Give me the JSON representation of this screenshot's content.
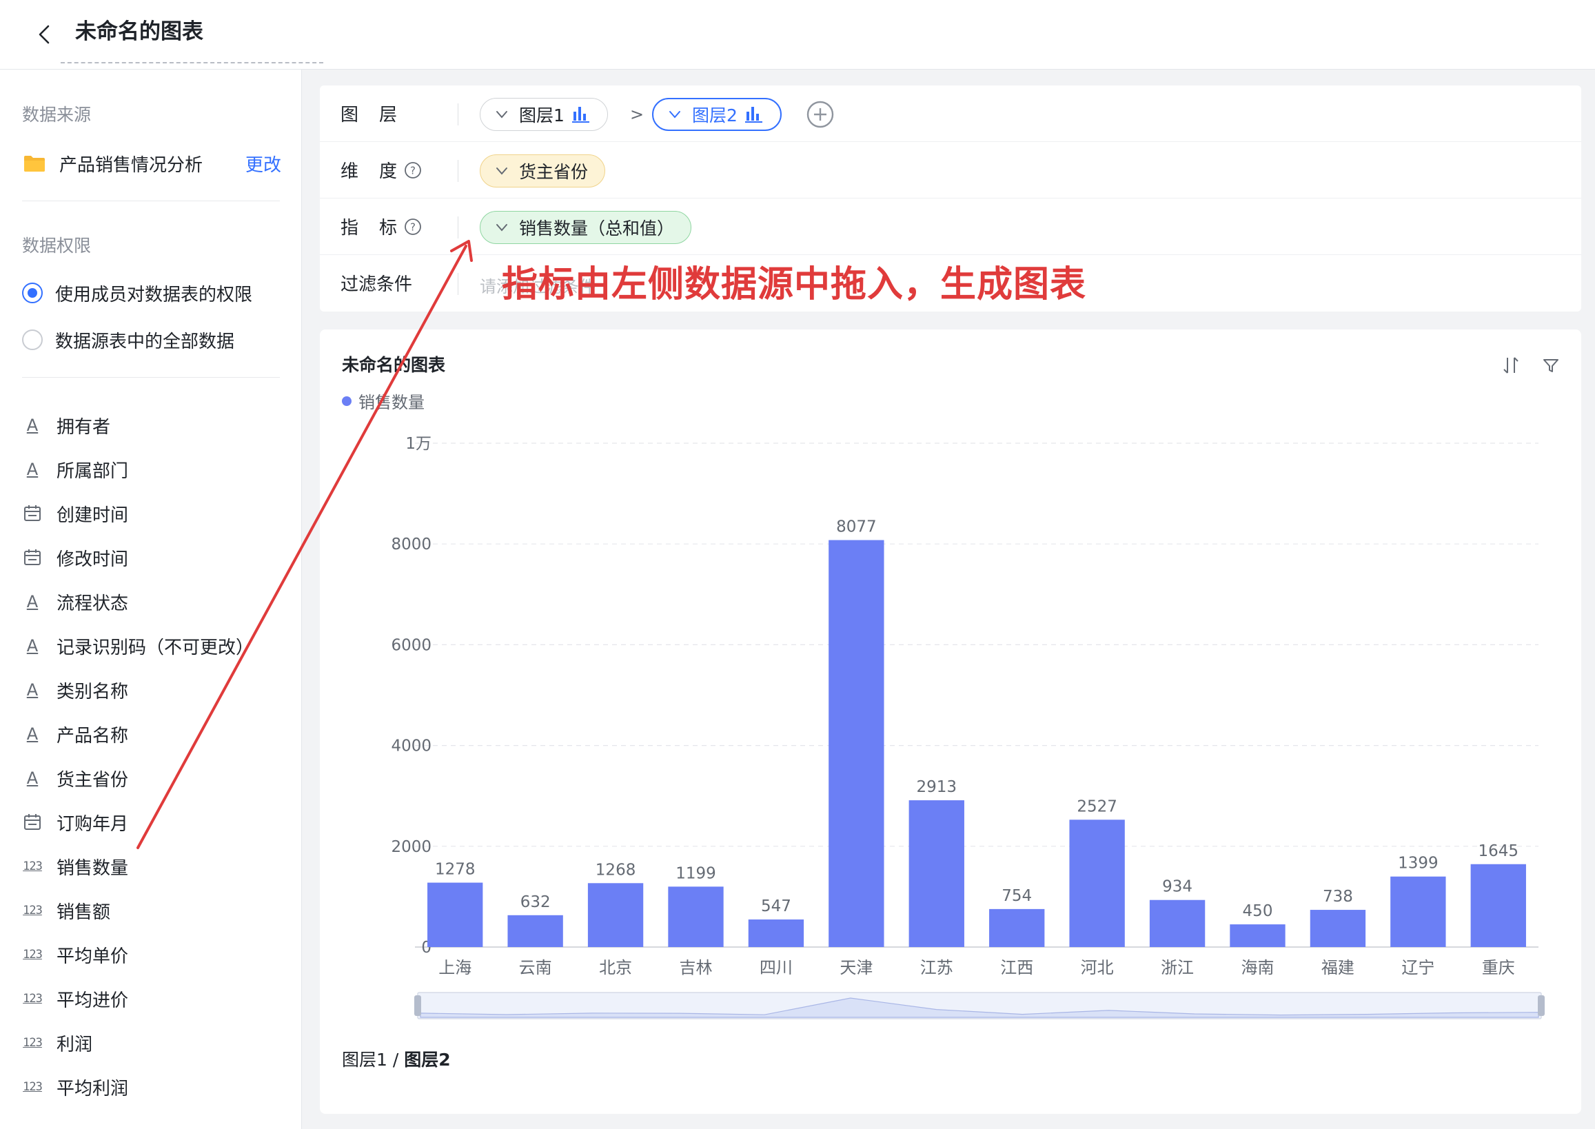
{
  "header": {
    "title": "未命名的图表"
  },
  "sidebar": {
    "data_source_label": "数据来源",
    "source_name": "产品销售情况分析",
    "change_label": "更改",
    "permission_label": "数据权限",
    "permission_options": [
      {
        "label": "使用成员对数据表的权限",
        "checked": true
      },
      {
        "label": "数据源表中的全部数据",
        "checked": false
      }
    ],
    "fields": [
      {
        "label": "拥有者",
        "type": "text"
      },
      {
        "label": "所属部门",
        "type": "text"
      },
      {
        "label": "创建时间",
        "type": "date"
      },
      {
        "label": "修改时间",
        "type": "date"
      },
      {
        "label": "流程状态",
        "type": "text"
      },
      {
        "label": "记录识别码（不可更改）",
        "type": "text"
      },
      {
        "label": "类别名称",
        "type": "text"
      },
      {
        "label": "产品名称",
        "type": "text"
      },
      {
        "label": "货主省份",
        "type": "text"
      },
      {
        "label": "订购年月",
        "type": "date"
      },
      {
        "label": "销售数量",
        "type": "number"
      },
      {
        "label": "销售额",
        "type": "number"
      },
      {
        "label": "平均单价",
        "type": "number"
      },
      {
        "label": "平均进价",
        "type": "number"
      },
      {
        "label": "利润",
        "type": "number"
      },
      {
        "label": "平均利润",
        "type": "number"
      }
    ]
  },
  "config": {
    "layer_label": [
      "图",
      "层"
    ],
    "dimension_label": [
      "维",
      "度"
    ],
    "metric_label": [
      "指",
      "标"
    ],
    "filter_label": "过滤条件",
    "layers": [
      "图层1",
      "图层2"
    ],
    "dimension_pill": "货主省份",
    "metric_pill": "销售数量（总和值）",
    "filter_placeholder": "请添加过滤条件"
  },
  "annotation": {
    "text": "指标由左侧数据源中拖入，生成图表"
  },
  "chart": {
    "title": "未命名的图表",
    "legend": "销售数量",
    "layer_path_prefix": "图层1 / ",
    "layer_path_current": "图层2"
  },
  "colors": {
    "accent": "#3370ff",
    "bar": "#6b7ff5",
    "annotation": "#e03b3b"
  },
  "chart_data": {
    "type": "bar",
    "title": "未命名的图表",
    "categories": [
      "上海",
      "云南",
      "北京",
      "吉林",
      "四川",
      "天津",
      "江苏",
      "江西",
      "河北",
      "浙江",
      "海南",
      "福建",
      "辽宁",
      "重庆"
    ],
    "series": [
      {
        "name": "销售数量",
        "values": [
          1278,
          632,
          1268,
          1199,
          547,
          8077,
          2913,
          754,
          2527,
          934,
          450,
          738,
          1399,
          1645
        ]
      }
    ],
    "y_ticks": [
      "0",
      "2000",
      "4000",
      "6000",
      "8000",
      "1万"
    ],
    "ylim": [
      0,
      10000
    ],
    "grid": true,
    "legend_position": "top-left",
    "show_data_labels": true,
    "xlabel": "",
    "ylabel": ""
  }
}
